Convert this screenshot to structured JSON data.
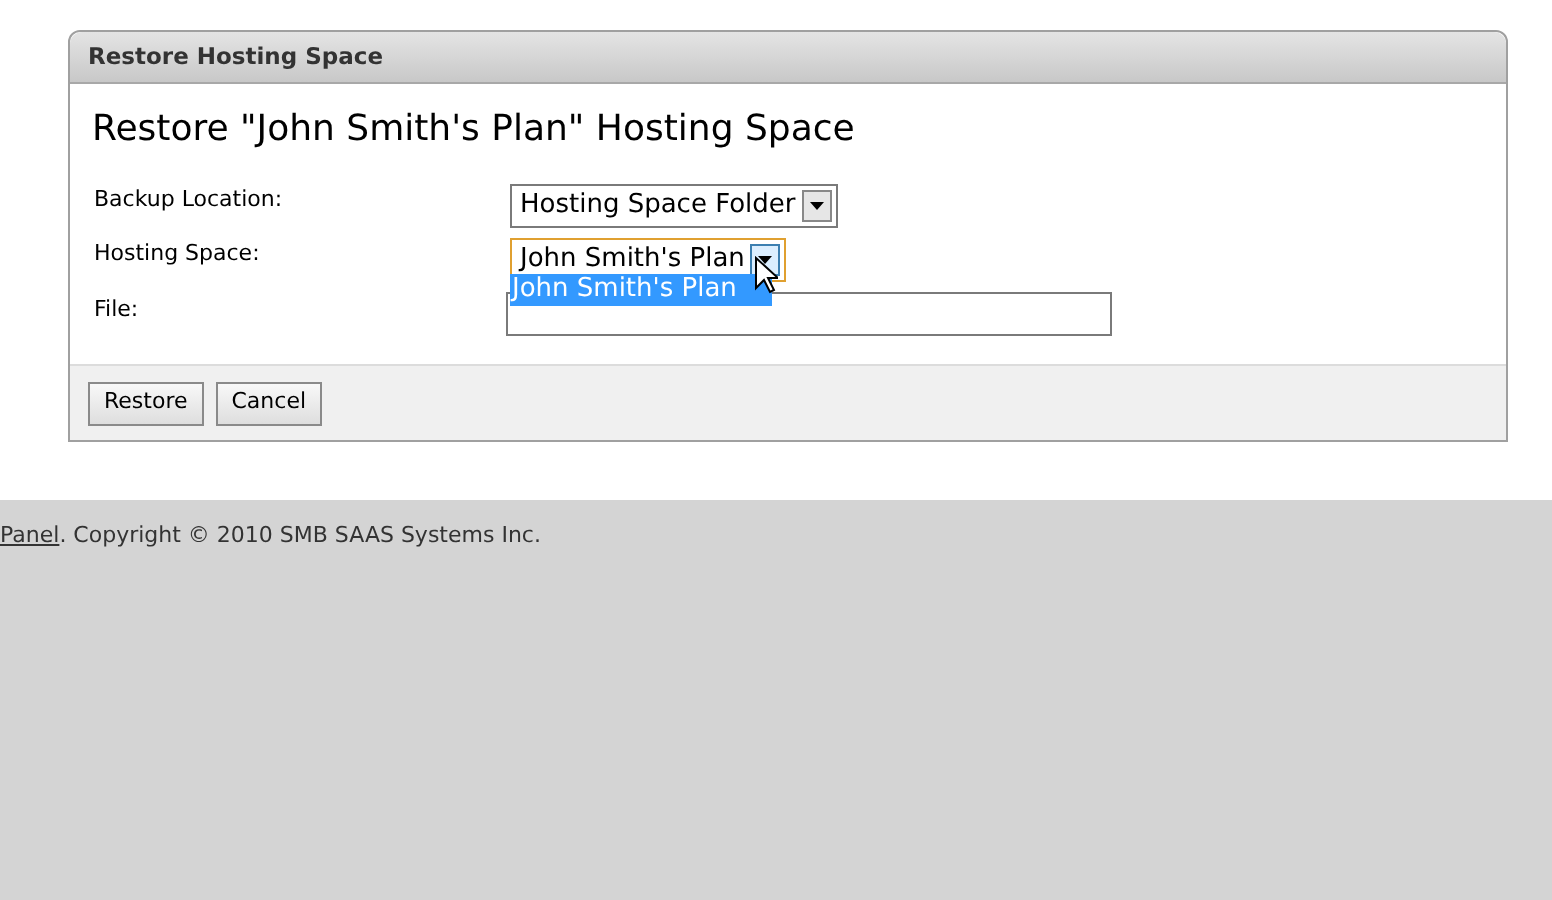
{
  "panel": {
    "header": "Restore Hosting Space",
    "title": "Restore \"John Smith's Plan\" Hosting Space",
    "fields": [
      {
        "label": "Backup Location:",
        "kind": "select",
        "value": "Hosting Space Folder",
        "expanded": false
      },
      {
        "label": "Hosting Space:",
        "kind": "select",
        "value": "John Smith's Plan",
        "expanded": true,
        "options": [
          {
            "label": "John Smith's Plan",
            "selected": true
          }
        ]
      },
      {
        "label": "File:",
        "kind": "text"
      }
    ],
    "buttons": [
      "Restore",
      "Cancel"
    ]
  },
  "footer": {
    "link": "Panel",
    "text": ". Copyright © 2010 SMB SAAS Systems Inc."
  }
}
